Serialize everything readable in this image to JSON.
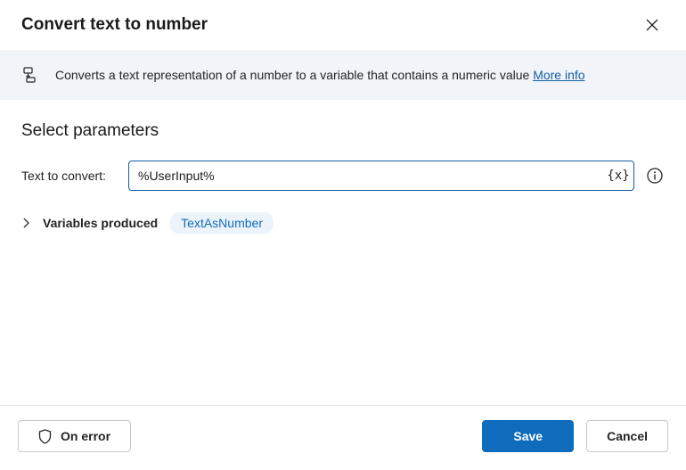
{
  "dialog": {
    "title": "Convert text to number"
  },
  "banner": {
    "text": "Converts a text representation of a number to a variable that contains a numeric value ",
    "link": "More info"
  },
  "section": {
    "heading": "Select parameters"
  },
  "params": {
    "textToConvert": {
      "label": "Text to convert:",
      "value": "%UserInput%"
    }
  },
  "variables": {
    "label": "Variables produced",
    "produced": "TextAsNumber"
  },
  "footer": {
    "onError": "On error",
    "save": "Save",
    "cancel": "Cancel"
  }
}
